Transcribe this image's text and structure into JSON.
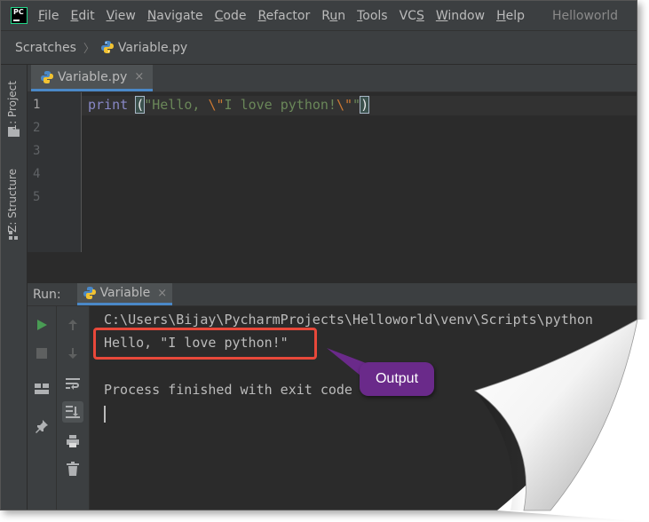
{
  "menu": {
    "items": [
      "File",
      "Edit",
      "View",
      "Navigate",
      "Code",
      "Refactor",
      "Run",
      "Tools",
      "VCS",
      "Window",
      "Help"
    ],
    "underline": [
      "F",
      "E",
      "V",
      "N",
      "C",
      "R",
      "u",
      "T",
      "S",
      "W",
      "H"
    ],
    "project_title": "Helloworld"
  },
  "breadcrumb": {
    "scratches": "Scratches",
    "file": "Variable.py"
  },
  "left_stripe": {
    "project_tab": "1: Project",
    "structure_tab": "Z: Structure"
  },
  "editor": {
    "tab_label": "Variable.py",
    "tab_close": "×",
    "line_numbers": [
      "1",
      "2",
      "3",
      "4",
      "5"
    ],
    "code": {
      "keyword": "print",
      "open_paren": "(",
      "str_part1": "\"Hello, ",
      "escape1": "\\\"",
      "str_part2": "I love python!",
      "escape2": "\\\"",
      "str_part3": "\"",
      "close_paren": ")"
    }
  },
  "run": {
    "label": "Run:",
    "tab_label": "Variable",
    "tab_close": "×"
  },
  "console": {
    "command": "C:\\Users\\Bijay\\PycharmProjects\\Helloworld\\venv\\Scripts\\python",
    "output": "Hello, \"I love python!\"",
    "finished": "Process finished with exit code"
  },
  "callout": {
    "text": "Output",
    "color": "#6a2a8a"
  },
  "colors": {
    "accent": "#4a88c7",
    "highlight": "#e8483a",
    "run_green": "#499c54"
  }
}
